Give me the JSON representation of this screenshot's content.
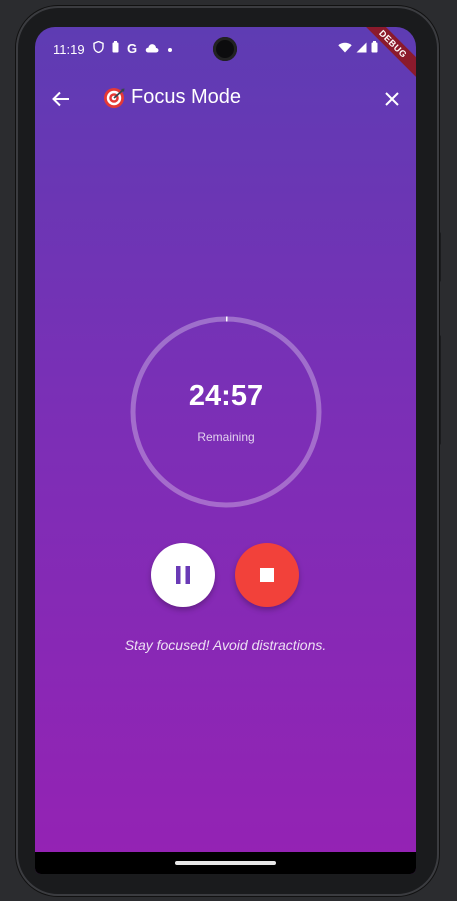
{
  "status_bar": {
    "time": "11:19",
    "left_icons": [
      "shield-icon",
      "battery-saver-icon",
      "google-icon",
      "cloud-icon",
      "dot-icon"
    ],
    "right_icons": [
      "wifi-icon",
      "signal-icon",
      "battery-icon"
    ],
    "debug_label": "DEBUG"
  },
  "app_bar": {
    "back_icon": "arrow-left-icon",
    "title_emoji_icon": "target-icon",
    "title": "Focus Mode",
    "close_icon": "close-icon"
  },
  "timer": {
    "time_remaining": "24:57",
    "label": "Remaining",
    "progress_fraction": 0.002
  },
  "controls": {
    "pause_icon": "pause-icon",
    "stop_icon": "stop-icon"
  },
  "hint_text": "Stay focused! Avoid distractions.",
  "colors": {
    "gradient_top": "#5e3cb3",
    "gradient_bottom": "#9522b4",
    "pause_bg": "#ffffff",
    "pause_icon": "#6a3ab6",
    "stop_bg": "#f2413a",
    "ring_track": "rgba(255,255,255,0.3)",
    "ring_progress": "#ffffff"
  }
}
